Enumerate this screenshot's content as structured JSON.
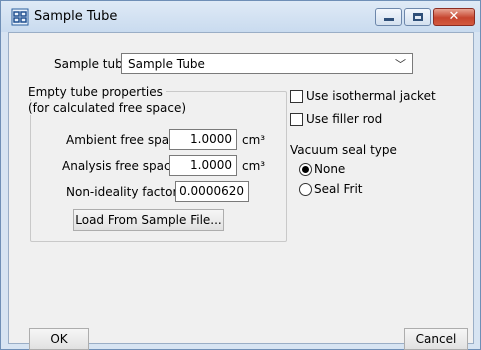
{
  "window": {
    "title": "Sample Tube",
    "close_glyph": "✕",
    "icon": "app-icon"
  },
  "sample_tube": {
    "label": "Sample tube:",
    "value": "Sample Tube",
    "arrow": "﹀"
  },
  "empty_tube": {
    "heading_line1": "Empty tube properties",
    "heading_line2": "(for calculated free space)",
    "ambient": {
      "label": "Ambient free space:",
      "value": "1.0000",
      "unit": "cm³"
    },
    "analysis": {
      "label": "Analysis free space:",
      "value": "1.0000",
      "unit": "cm³"
    },
    "nonideality": {
      "label": "Non-ideality factor:",
      "value": "0.0000620"
    },
    "load_button": "Load From Sample File..."
  },
  "options": {
    "isothermal": {
      "label": "Use isothermal jacket",
      "checked": false
    },
    "filler": {
      "label": "Use filler rod",
      "checked": false
    }
  },
  "vacuum_seal": {
    "label": "Vacuum seal type",
    "options": [
      {
        "label": "None",
        "selected": true
      },
      {
        "label": "Seal Frit",
        "selected": false
      }
    ]
  },
  "footer": {
    "ok_label": "OK",
    "cancel_label": "Cancel"
  }
}
